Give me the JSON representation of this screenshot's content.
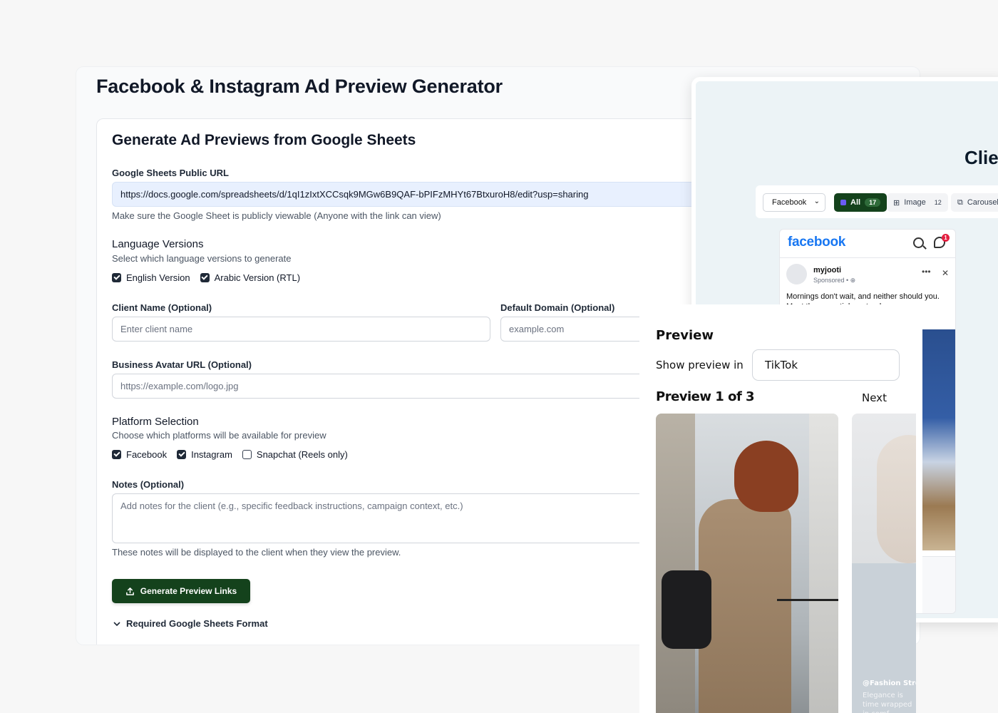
{
  "app": {
    "title": "Facebook & Instagram Ad Preview Generator"
  },
  "form": {
    "card_title": "Generate Ad Previews from Google Sheets",
    "sheet_url_label": "Google Sheets Public URL",
    "sheet_url_value": "https://docs.google.com/spreadsheets/d/1qI1zIxtXCCsqk9MGw6B9QAF-bPIFzMHYt67BtxuroH8/edit?usp=sharing",
    "sheet_url_help": "Make sure the Google Sheet is publicly viewable (Anyone with the link can view)",
    "language_title": "Language Versions",
    "language_subtitle": "Select which language versions to generate",
    "english_label": "English Version",
    "arabic_label": "Arabic Version (RTL)",
    "client_name_label": "Client Name (Optional)",
    "client_name_placeholder": "Enter client name",
    "default_domain_label": "Default Domain (Optional)",
    "default_domain_placeholder": "example.com",
    "avatar_label": "Business Avatar URL (Optional)",
    "avatar_placeholder": "https://example.com/logo.jpg",
    "platform_title": "Platform Selection",
    "platform_subtitle": "Choose which platforms will be available for preview",
    "platform_facebook": "Facebook",
    "platform_instagram": "Instagram",
    "platform_snapchat": "Snapchat (Reels only)",
    "notes_label": "Notes (Optional)",
    "notes_placeholder": "Add notes for the client (e.g., specific feedback instructions, campaign context, etc.)",
    "notes_help": "These notes will be displayed to the client when they view the preview.",
    "generate_label": "Generate Preview Links",
    "required_format_label": "Required Google Sheets Format"
  },
  "client_window": {
    "title": "Clie",
    "select_value": "Facebook",
    "chip_all": "All",
    "chip_all_count": "17",
    "chip_image": "Image",
    "chip_image_count": "12",
    "chip_carousel": "Carousel",
    "fb_logo": "facebook",
    "notification_count": "1",
    "post_name": "myjooti",
    "post_sponsored": "Sponsored • ⊕",
    "post_text": "Mornings don't wait, and neither should you. Meet the essential … steady,"
  },
  "preview": {
    "title": "Preview",
    "show_label": "Show preview in",
    "platform_value": "TikTok",
    "count_label": "Preview 1 of 3",
    "next_label": "Next",
    "card2_handle": "@Fashion Stree",
    "card2_caption": "Elegance is time wrapped in comf"
  }
}
